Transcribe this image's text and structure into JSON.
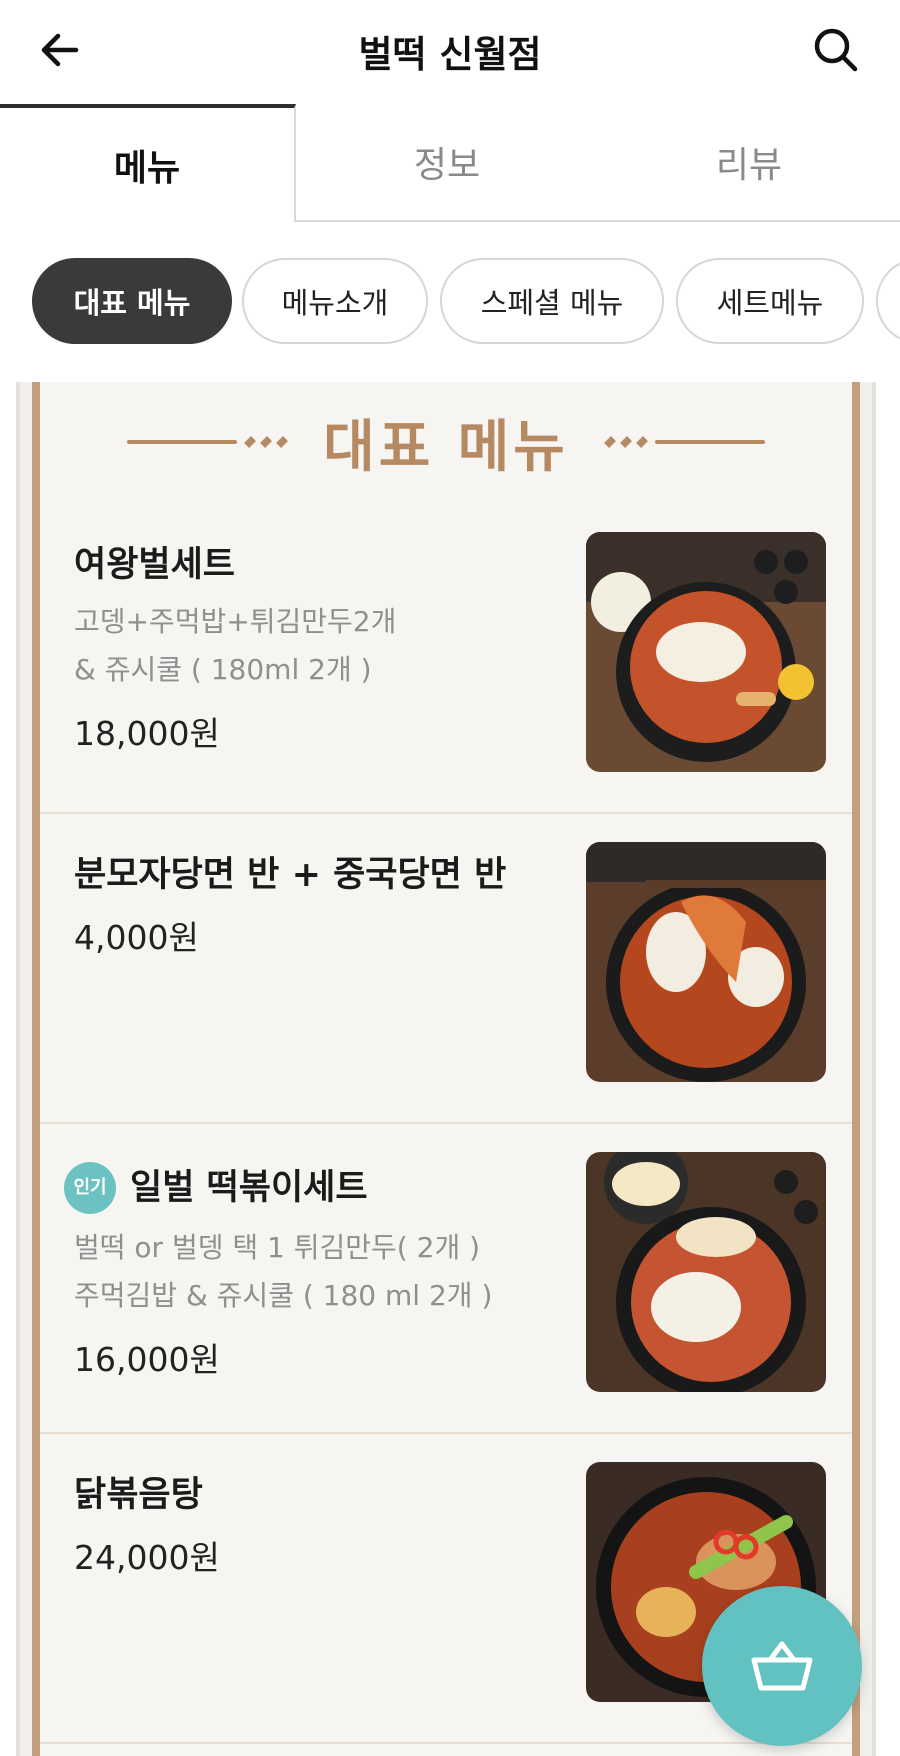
{
  "header": {
    "title": "벌떡 신월점",
    "back_icon": "arrow-left-icon",
    "search_icon": "search-icon"
  },
  "tabs": [
    {
      "label": "메뉴",
      "active": true
    },
    {
      "label": "정보",
      "active": false
    },
    {
      "label": "리뷰",
      "active": false
    }
  ],
  "chips": [
    {
      "label": "대표 메뉴",
      "active": true
    },
    {
      "label": "메뉴소개",
      "active": false
    },
    {
      "label": "스페셜 메뉴",
      "active": false
    },
    {
      "label": "세트메뉴",
      "active": false
    },
    {
      "label": "",
      "active": false
    }
  ],
  "board": {
    "heading": "대표 메뉴",
    "accent_color": "#b58a62"
  },
  "items": [
    {
      "name": "여왕벌세트",
      "desc1": "고뎅+주먹밥+튀김만두2개",
      "desc2": "& 쥬시쿨 ( 180ml 2개 )",
      "price": "18,000원",
      "badge": ""
    },
    {
      "name": "분모자당면 반 + 중국당면 반",
      "desc1": "",
      "desc2": "",
      "price": "4,000원",
      "badge": ""
    },
    {
      "name": "일벌 떡볶이세트",
      "desc1": "벌떡 or 벌뎅 택 1 튀김만두( 2개 )",
      "desc2": "주먹김밥 & 쥬시쿨 ( 180 ml 2개 )",
      "price": "16,000원",
      "badge": "인기"
    },
    {
      "name": "닭볶음탕",
      "desc1": "",
      "desc2": "",
      "price": "24,000원",
      "badge": ""
    }
  ],
  "cart": {
    "icon": "basket-icon",
    "color": "#62c1c1"
  }
}
